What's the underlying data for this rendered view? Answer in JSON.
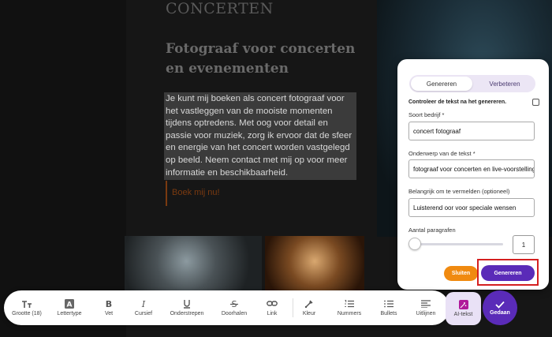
{
  "page": {
    "heading_small": "CONCERTEN",
    "heading": "Fotograaf voor concerten en evenementen",
    "paragraph": "Je kunt mij boeken als concert fotograaf voor het vastleggen van de mooiste momenten tijdens optredens. Met oog voor detail en passie voor muziek, zorg ik ervoor dat de sfeer en energie van het concert worden vastgelegd op beeld. Neem contact met mij op voor meer informatie en beschikbaarheid.",
    "book_button": "Boek mij nu!"
  },
  "ai_panel": {
    "tabs": [
      "Genereren",
      "Verbeteren"
    ],
    "check_label": "Controleer de tekst na het genereren.",
    "fields": [
      {
        "label": "Soort bedrijf  *",
        "value": "concert fotograaf"
      },
      {
        "label": "Onderwerp van de tekst  *",
        "value": "fotograaf voor concerten en live-voorstellingen"
      },
      {
        "label": "Belangrijk om te vermelden (optioneel)",
        "value": "Luisterend oor voor speciale wensen"
      }
    ],
    "paragraphs_label": "Aantal paragrafen",
    "paragraphs_value": "1",
    "close_button": "Sluiten",
    "generate_button": "Genereren"
  },
  "toolbar": {
    "items": [
      {
        "label": "Grootte (18)",
        "icon": "font-size-icon"
      },
      {
        "label": "Lettertype",
        "icon": "font-family-icon"
      },
      {
        "label": "Vet",
        "icon": "bold-icon"
      },
      {
        "label": "Cursief",
        "icon": "italic-icon"
      },
      {
        "label": "Onderstrepen",
        "icon": "underline-icon"
      },
      {
        "label": "Doorhalen",
        "icon": "strikethrough-icon"
      },
      {
        "label": "Link",
        "icon": "link-icon"
      },
      {
        "label": "Kleur",
        "icon": "color-picker-icon"
      },
      {
        "label": "Nummers",
        "icon": "numbered-list-icon"
      },
      {
        "label": "Bullets",
        "icon": "bullet-list-icon"
      },
      {
        "label": "Uitlijnen",
        "icon": "align-icon"
      }
    ],
    "ai_label": "AI-tekst",
    "done_label": "Gedaan"
  },
  "colors": {
    "accent": "#5a2bb8",
    "close_orange": "#f08a10",
    "highlight_red": "#d42020",
    "ai_magenta": "#b0189a"
  }
}
